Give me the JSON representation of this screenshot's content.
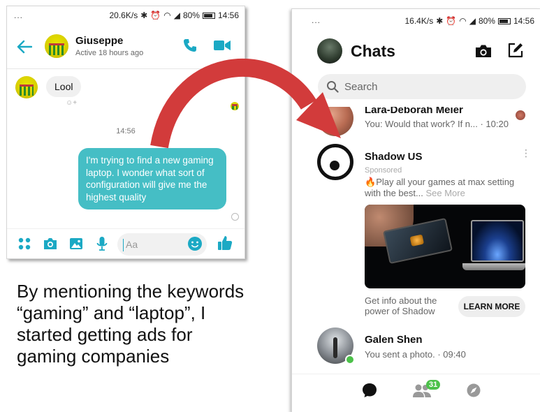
{
  "left_phone": {
    "status": {
      "dots": "...",
      "speed": "20.6K/s",
      "battery": "80%",
      "time": "14:56"
    },
    "header": {
      "name": "Giuseppe",
      "subtitle": "Active 18 hours ago"
    },
    "messages": {
      "incoming": "Lool",
      "timestamp": "14:56",
      "outgoing": "I'm trying to find a new gaming laptop. I wonder what sort of configuration will give me the highest quality"
    },
    "composer": {
      "placeholder": "Aa"
    }
  },
  "caption": "By mentioning the keywords “gaming” and “laptop”, I started getting ads for gaming companies",
  "right_phone": {
    "status": {
      "dots": "...",
      "speed": "16.4K/s",
      "battery": "80%",
      "time": "14:56"
    },
    "title": "Chats",
    "search": {
      "placeholder": "Search"
    },
    "conversations": [
      {
        "name": "Lara-Deborah Meier",
        "preview": "You: Would that work? If n... · 10:20"
      },
      {
        "name": "Shadow US",
        "sponsored": "Sponsored",
        "ad_text": "Play all your games at max setting with the best...",
        "see_more": "See More",
        "cta_text": "Get info about the power of Shadow",
        "cta_button": "LEARN MORE"
      },
      {
        "name": "Galen Shen",
        "preview": "You sent a photo. · 09:40"
      }
    ],
    "tabs": {
      "people_badge": "31"
    }
  },
  "colors": {
    "messenger_teal": "#1ba9c4",
    "outgoing_bubble": "#45bec5",
    "arrow_red": "#d23b3b",
    "online_green": "#4cc14a"
  }
}
